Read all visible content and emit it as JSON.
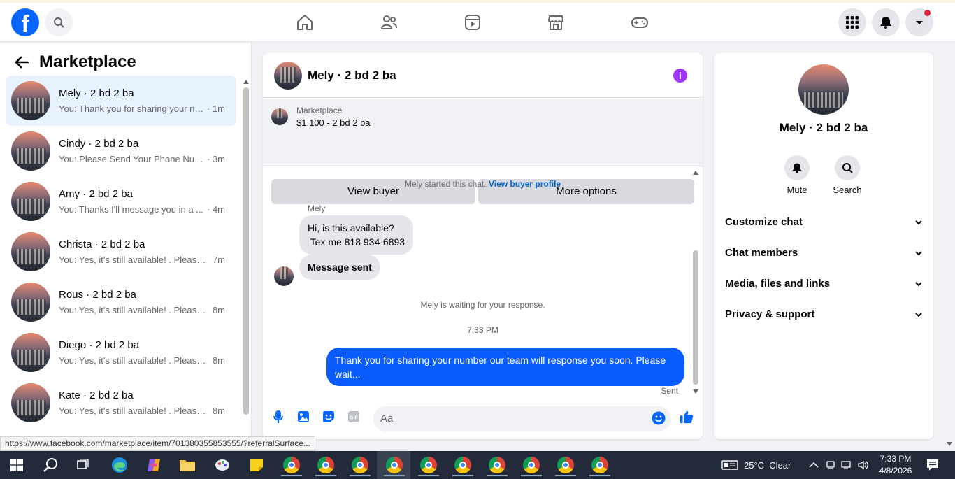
{
  "nav": {
    "logo": "f",
    "icons": [
      "home-icon",
      "friends-icon",
      "video-icon",
      "marketplace-icon",
      "gaming-icon"
    ],
    "right_icons": [
      "menu-grid-icon",
      "notifications-icon",
      "account-caret-icon"
    ]
  },
  "sidebar": {
    "title": "Marketplace",
    "conversations": [
      {
        "name": "Mely · 2 bd 2 ba",
        "preview": "You: Thank you for sharing your nu...",
        "time": "· 1m",
        "active": true
      },
      {
        "name": "Cindy · 2 bd 2 ba",
        "preview": "You: Please Send Your Phone Num...",
        "time": "· 3m"
      },
      {
        "name": "Amy · 2 bd 2 ba",
        "preview": "You: Thanks I'll message you in a ...",
        "time": "· 4m"
      },
      {
        "name": "Christa · 2 bd 2 ba",
        "preview": "You: Yes, it's still available! . Please ...",
        "time": "7m"
      },
      {
        "name": "Rous · 2 bd 2 ba",
        "preview": "You: Yes, it's still available! . Please ...",
        "time": "8m"
      },
      {
        "name": "Diego · 2 bd 2 ba",
        "preview": "You: Yes, it's still available! . Please ...",
        "time": "8m"
      },
      {
        "name": "Kate · 2 bd 2 ba",
        "preview": "You: Yes, it's still available! . Please ...",
        "time": "8m"
      }
    ]
  },
  "chat": {
    "title": "Mely · 2 bd 2 ba",
    "marketplace_label": "Marketplace",
    "listing": "$1,100 - 2 bd 2 ba",
    "view_buyer": "View buyer",
    "more_options": "More options",
    "started_text": "Mely started this chat.",
    "view_buyer_profile": "View buyer profile",
    "sender": "Mely",
    "msg1": "Hi, is this available?\n Tex me 818 934-6893",
    "msg2": "Message sent",
    "waiting": "Mely is waiting for your response.",
    "time": "7:33 PM",
    "outgoing": "Thank you for sharing your number our team will response you soon. Please wait...",
    "sent": "Sent",
    "input_placeholder": "Aa"
  },
  "panel": {
    "name": "Mely · 2 bd 2 ba",
    "mute": "Mute",
    "search": "Search",
    "sections": [
      "Customize chat",
      "Chat members",
      "Media, files and links",
      "Privacy & support"
    ]
  },
  "status_url": "https://www.facebook.com/marketplace/item/701380355853555/?referralSurface...",
  "taskbar": {
    "weather": "25°C  Clear",
    "time": "7:33 PM",
    "date": "4/8/2026"
  },
  "colors": {
    "brand": "#0866ff",
    "outgoing_bubble": "#0a5cff",
    "info": "#a033ff"
  }
}
